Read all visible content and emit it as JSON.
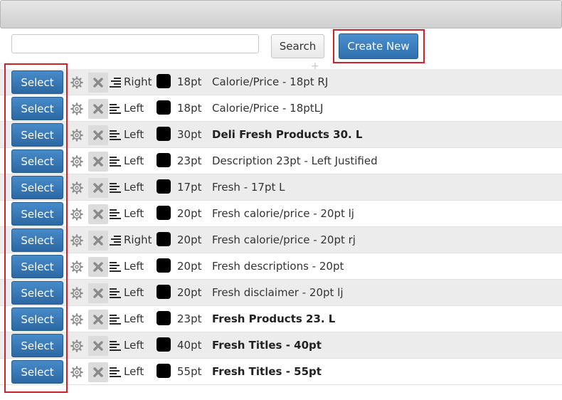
{
  "toolbar": {
    "search_placeholder": "",
    "search_button": "Search",
    "create_button": "Create New",
    "plus_glyph": "+"
  },
  "rows": [
    {
      "select": "Select",
      "align": "Right",
      "align_icon": "align-right-icon",
      "color": "#000000",
      "size": "18pt",
      "name": "Calorie/Price - 18pt RJ",
      "bold": false
    },
    {
      "select": "Select",
      "align": "Left",
      "align_icon": "align-left-icon",
      "color": "#000000",
      "size": "18pt",
      "name": "Calorie/Price - 18ptLJ",
      "bold": false
    },
    {
      "select": "Select",
      "align": "Left",
      "align_icon": "align-left-icon",
      "color": "#000000",
      "size": "30pt",
      "name": "Deli Fresh Products 30. L",
      "bold": true
    },
    {
      "select": "Select",
      "align": "Left",
      "align_icon": "align-left-icon",
      "color": "#000000",
      "size": "23pt",
      "name": "Description 23pt - Left Justified",
      "bold": false
    },
    {
      "select": "Select",
      "align": "Left",
      "align_icon": "align-left-icon",
      "color": "#000000",
      "size": "17pt",
      "name": "Fresh - 17pt L",
      "bold": false
    },
    {
      "select": "Select",
      "align": "Left",
      "align_icon": "align-left-icon",
      "color": "#000000",
      "size": "20pt",
      "name": "Fresh calorie/price - 20pt lj",
      "bold": false
    },
    {
      "select": "Select",
      "align": "Right",
      "align_icon": "align-right-icon",
      "color": "#000000",
      "size": "20pt",
      "name": "Fresh calorie/price - 20pt rj",
      "bold": false
    },
    {
      "select": "Select",
      "align": "Left",
      "align_icon": "align-left-icon",
      "color": "#000000",
      "size": "20pt",
      "name": "Fresh descriptions - 20pt",
      "bold": false
    },
    {
      "select": "Select",
      "align": "Left",
      "align_icon": "align-left-icon",
      "color": "#000000",
      "size": "20pt",
      "name": "Fresh disclaimer - 20pt lj",
      "bold": false
    },
    {
      "select": "Select",
      "align": "Left",
      "align_icon": "align-left-icon",
      "color": "#000000",
      "size": "23pt",
      "name": "Fresh Products 23. L",
      "bold": true
    },
    {
      "select": "Select",
      "align": "Left",
      "align_icon": "align-left-icon",
      "color": "#000000",
      "size": "40pt",
      "name": "Fresh Titles - 40pt",
      "bold": true
    },
    {
      "select": "Select",
      "align": "Left",
      "align_icon": "align-left-icon",
      "color": "#000000",
      "size": "55pt",
      "name": "Fresh Titles - 55pt",
      "bold": true
    }
  ],
  "colors": {
    "highlight_border": "#d0202a",
    "button_blue": "#2f6fae",
    "row_alt": "#ececec"
  }
}
